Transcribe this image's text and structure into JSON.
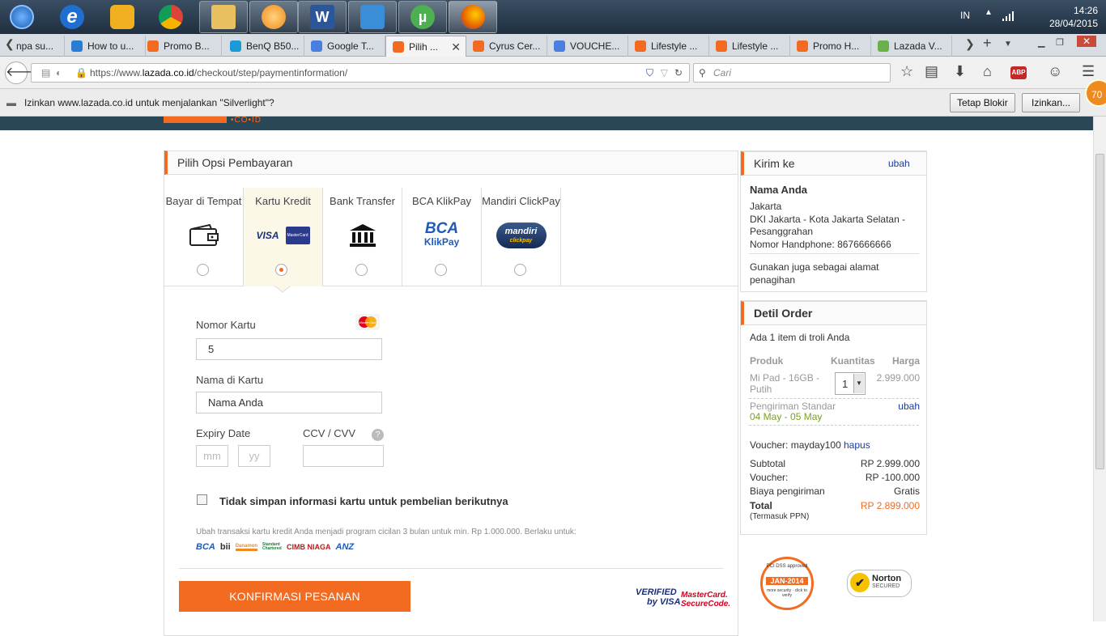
{
  "taskbar": {
    "apps": [
      {
        "name": "start-orb",
        "color": "#2a7bd4"
      },
      {
        "name": "internet-explorer",
        "color": "#1e6fd0"
      },
      {
        "name": "game-controller",
        "color": "#f0b020"
      },
      {
        "name": "chrome",
        "color": "#2fa84f"
      },
      {
        "name": "folder",
        "color": "#e8c060"
      },
      {
        "name": "media-player",
        "color": "#f08a1e"
      },
      {
        "name": "word",
        "color": "#2b579a"
      },
      {
        "name": "video-player",
        "color": "#3a8ed8"
      },
      {
        "name": "utorrent",
        "color": "#4caf50"
      },
      {
        "name": "firefox",
        "color": "#e66000"
      }
    ],
    "lang": "IN",
    "time": "14:26",
    "date": "28/04/2015"
  },
  "tabs": [
    {
      "label": "npa su...",
      "fav": "#999"
    },
    {
      "label": "How to u...",
      "fav": "#2a7bd4"
    },
    {
      "label": "Promo B...",
      "fav": "#f26b21"
    },
    {
      "label": "BenQ B50...",
      "fav": "#1c9ad6"
    },
    {
      "label": "Google T...",
      "fav": "#4a7fe0"
    },
    {
      "label": "Pilih ...",
      "fav": "#f26b21"
    },
    {
      "label": "Cyrus Cer...",
      "fav": "#f26b21"
    },
    {
      "label": "VOUCHE...",
      "fav": "#4a7fe0"
    },
    {
      "label": "Lifestyle ...",
      "fav": "#f26b21"
    },
    {
      "label": "Lifestyle ...",
      "fav": "#f26b21"
    },
    {
      "label": "Promo H...",
      "fav": "#f26b21"
    },
    {
      "label": "Lazada V...",
      "fav": "#6ab04c"
    }
  ],
  "nav": {
    "url_prefix": "https://www.",
    "url_domain": "lazada.co.id",
    "url_path": "/checkout/step/paymentinformation/",
    "search_placeholder": "Cari"
  },
  "notice": {
    "text": "Izinkan www.lazada.co.id untuk menjalankan \"Silverlight\"?",
    "block": "Tetap Blokir",
    "allow": "Izinkan...",
    "badge": "70"
  },
  "header": {
    "logo_sub": "•CO•ID"
  },
  "payment": {
    "title": "Pilih Opsi Pembayaran",
    "options": [
      {
        "label": "Bayar di Tempat"
      },
      {
        "label": "Kartu Kredit",
        "icon1": "VISA",
        "icon2": "MasterCard"
      },
      {
        "label": "Bank Transfer"
      },
      {
        "label": "BCA KlikPay",
        "icon1": "BCA",
        "icon2": "KlikPay"
      },
      {
        "label": "Mandiri ClickPay",
        "icon1": "mandiri",
        "icon2": "clickpay"
      }
    ],
    "selected": 1,
    "card_number_label": "Nomor Kartu",
    "card_number_value": "5",
    "card_brand_icon": "MasterCard",
    "name_label": "Nama di Kartu",
    "name_value": "Nama Anda",
    "expiry_label": "Expiry Date",
    "mm_placeholder": "mm",
    "yy_placeholder": "yy",
    "ccv_label": "CCV / CVV",
    "help": "?",
    "save_label": "Tidak simpan informasi kartu untuk pembelian berikutnya",
    "cicilan": "Ubah transaksi kartu kredit Anda menjadi program cicilan 3 bulan untuk min. Rp 1.000.000. Berlaku untuk:",
    "banks": [
      "BCA",
      "bii",
      "Danamon",
      "Standard Chartered",
      "CIMB NIAGA",
      "ANZ"
    ],
    "confirm": "KONFIRMASI PESANAN",
    "vbv": [
      "VERIFIED",
      "by VISA"
    ],
    "msc": [
      "MasterCard.",
      "SecureCode."
    ]
  },
  "ship": {
    "title": "Kirim ke",
    "edit": "ubah",
    "name": "Nama Anda",
    "city": "Jakarta",
    "region": "DKI Jakarta - Kota Jakarta Selatan - Pesanggrahan",
    "phone": "Nomor Handphone: 8676666666",
    "billing": "Gunakan juga sebagai alamat penagihan"
  },
  "order": {
    "title": "Detil Order",
    "count": "Ada 1 item di troli Anda",
    "col_product": "Produk",
    "col_qty": "Kuantitas",
    "col_price": "Harga",
    "product": "Mi Pad - 16GB - Putih",
    "qty": "1",
    "price": "2.999.000",
    "shipping": "Pengiriman Standar",
    "shipping_dates": "04 May - 05 May",
    "shipping_edit": "ubah",
    "voucher_label": "Voucher: mayday100",
    "voucher_remove": "hapus",
    "subtotal_label": "Subtotal",
    "subtotal": "RP 2.999.000",
    "voucher_line": "Voucher:",
    "voucher_amount": "RP -100.000",
    "ship_cost_label": "Biaya pengiriman",
    "ship_cost": "Gratis",
    "total_label": "Total",
    "total_note": "(Termasuk PPN)",
    "total": "RP 2.899.000"
  },
  "trust": {
    "pci_top": "PCI DSS approved",
    "pci_date": "JAN-2014",
    "pci_bottom": "more security · click to verify",
    "norton": "Norton",
    "norton_sub": "SECURED"
  },
  "colors": {
    "accent": "#f26b21",
    "link": "#1a3c9a",
    "green": "#7aa51a"
  }
}
